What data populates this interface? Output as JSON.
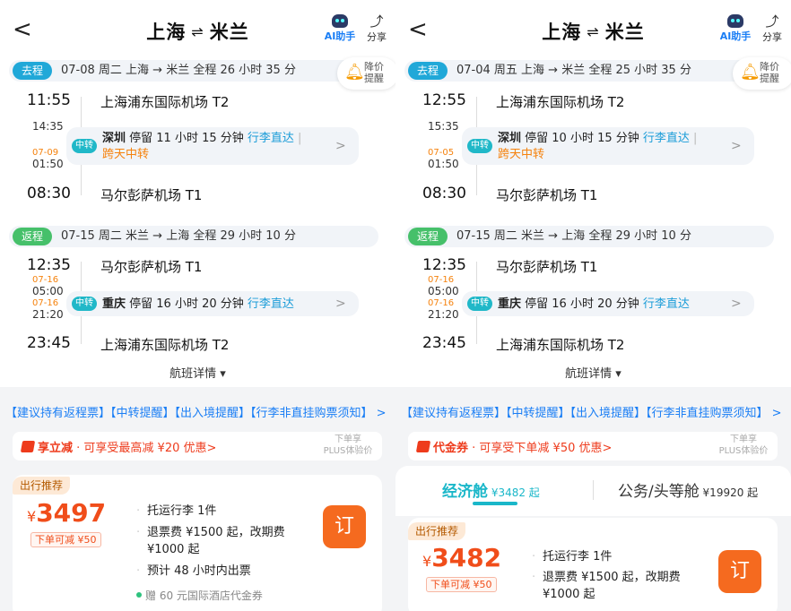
{
  "left": {
    "header": {
      "from": "上海",
      "sep": "⇌",
      "to": "米兰",
      "ai_label": "AI助手",
      "share_label": "分享",
      "back": "<"
    },
    "alert": {
      "label": "降价提醒"
    },
    "outbound": {
      "tag": "去程",
      "info": "07-08 周二   上海 → 米兰   全程 26 小时 35 分",
      "dep_time": "11:55",
      "dep_airport": "上海浦东国际机场 T2",
      "stop_arr_time": "14:35",
      "stop_dep_date": "07-09",
      "stop_dep_time": "01:50",
      "transfer_tag": "中转",
      "stop_city": "深圳",
      "stop_text": " 停留 11 小时 15 分钟 ",
      "luggage": "行李直达",
      "pipe": " | ",
      "extra": "跨天中转",
      "arr_time": "08:30",
      "arr_airport": "马尔彭萨机场 T1"
    },
    "return": {
      "tag": "返程",
      "info": "07-15 周二   米兰 → 上海   全程 29 小时 10 分",
      "dep_time": "12:35",
      "dep_airport": "马尔彭萨机场 T1",
      "stop_arr_date": "07-16",
      "stop_arr_time": "05:00",
      "stop_dep_date": "07-16",
      "stop_dep_time": "21:20",
      "transfer_tag": "中转",
      "stop_city": "重庆",
      "stop_text": " 停留 16 小时 20 分钟 ",
      "luggage": "行李直达",
      "arr_time": "23:45",
      "arr_airport": "上海浦东国际机场 T2"
    },
    "detail_link": "航班详情 ▾",
    "notice": "【建议持有返程票】【中转提醒】【出入境提醒】【行李非直挂购票须知】 >",
    "promo": {
      "name": "享立减",
      "text": " · 可享受最高减 ¥20 优惠>",
      "side1": "下单享",
      "side2": "PLUS体验价"
    },
    "card": {
      "rec_tag": "出行推荐",
      "currency": "¥",
      "price": "3497",
      "reduce": "下单可减  ¥50",
      "features": [
        "托运行李 1件",
        "退票费 ¥1500 起，改期费 ¥1000 起",
        "预计 48 小时内出票"
      ],
      "gift": "赠 60 元国际酒店代金券",
      "book": "订"
    }
  },
  "right": {
    "header": {
      "from": "上海",
      "sep": "⇌",
      "to": "米兰",
      "ai_label": "AI助手",
      "share_label": "分享",
      "back": "<"
    },
    "alert": {
      "label": "降价提醒"
    },
    "outbound": {
      "tag": "去程",
      "info": "07-04 周五   上海 → 米兰   全程 25 小时 35 分",
      "dep_time": "12:55",
      "dep_airport": "上海浦东国际机场 T2",
      "stop_arr_time": "15:35",
      "stop_dep_date": "07-05",
      "stop_dep_time": "01:50",
      "transfer_tag": "中转",
      "stop_city": "深圳",
      "stop_text": " 停留 10 小时 15 分钟 ",
      "luggage": "行李直达",
      "pipe": " | ",
      "extra": "跨天中转",
      "arr_time": "08:30",
      "arr_airport": "马尔彭萨机场 T1"
    },
    "return": {
      "tag": "返程",
      "info": "07-15 周二   米兰 → 上海   全程 29 小时 10 分",
      "dep_time": "12:35",
      "dep_airport": "马尔彭萨机场 T1",
      "stop_arr_date": "07-16",
      "stop_arr_time": "05:00",
      "stop_dep_date": "07-16",
      "stop_dep_time": "21:20",
      "transfer_tag": "中转",
      "stop_city": "重庆",
      "stop_text": " 停留 16 小时 20 分钟 ",
      "luggage": "行李直达",
      "arr_time": "23:45",
      "arr_airport": "上海浦东国际机场 T2"
    },
    "detail_link": "航班详情 ▾",
    "notice": "【建议持有返程票】【中转提醒】【出入境提醒】【行李非直挂购票须知】 >",
    "promo": {
      "name": "代金券",
      "text": " · 可享受下单减 ¥50 优惠>",
      "side1": "下单享",
      "side2": "PLUS体验价"
    },
    "cabins": {
      "economy": "经济舱",
      "economy_price": " ¥3482 起",
      "business": "公务/头等舱",
      "business_price": " ¥19920 起"
    },
    "card": {
      "rec_tag": "出行推荐",
      "currency": "¥",
      "price": "3482",
      "reduce": "下单可减  ¥50",
      "features": [
        "托运行李 1件",
        "退票费 ¥1500 起，改期费 ¥1000 起"
      ],
      "book": "订"
    }
  },
  "colors": {
    "accent": "#1a7ef5",
    "teal": "#20b8c8",
    "orange": "#f5820d",
    "price": "#f04d1a",
    "go_tag": "#20a8d8",
    "ret_tag": "#46c06a"
  }
}
